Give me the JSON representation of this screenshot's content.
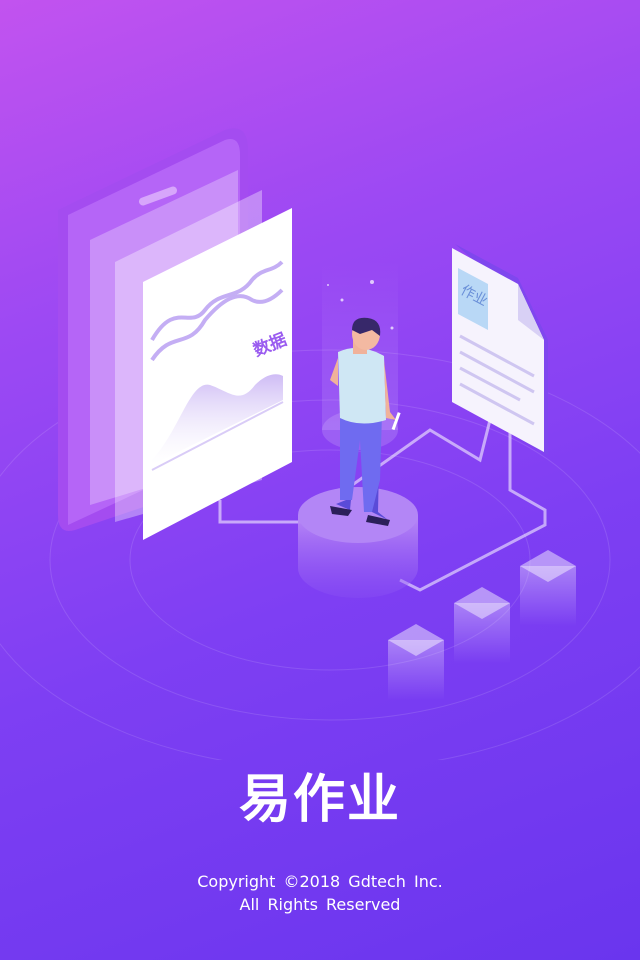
{
  "splash": {
    "illustration": {
      "chart_card_label": "数据",
      "document_label": "作业"
    },
    "app_name": "易作业",
    "copyright": "Copyright ©2018  Gdtech Inc.",
    "rights": "All  Rights  Reserved"
  },
  "colors": {
    "background_top": "#c253ef",
    "background_bottom": "#6a35ee",
    "text": "#ffffff",
    "accent_label": "#9a5cf0"
  }
}
